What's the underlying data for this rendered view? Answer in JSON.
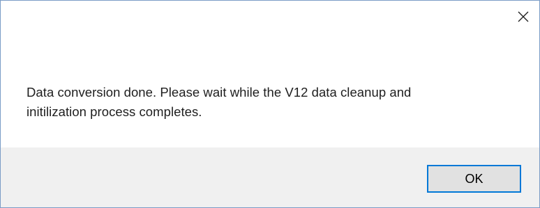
{
  "dialog": {
    "message": "Data conversion done. Please wait while the V12 data cleanup and initilization process completes.",
    "message_line1": "Data conversion done. Please wait while the V12 data cleanup and",
    "message_line2": "initilization process completes.",
    "ok_label": "OK",
    "close_icon": "close-icon"
  },
  "colors": {
    "window_border": "#7a9cc6",
    "footer_background": "#f0f0f0",
    "button_face": "#e1e1e1",
    "button_focus_border": "#0078d7",
    "text": "#1e1e1e"
  }
}
